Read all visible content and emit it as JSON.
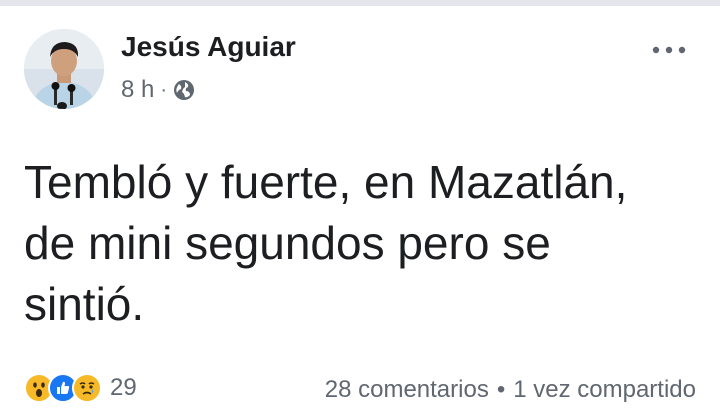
{
  "post": {
    "author": "Jesús Aguiar",
    "time": "8 h",
    "separator": "·",
    "privacy_icon": "globe-icon",
    "text": "Tembló y fuerte, en Mazatlán,\nde mini segundos pero se\nsintió.",
    "reactions": {
      "icons": [
        "wow-emoji-icon",
        "like-icon",
        "sad-emoji-icon"
      ],
      "count": "29"
    },
    "comments": "28 comentarios",
    "dot": "•",
    "shares": "1 vez compartido"
  },
  "colors": {
    "like_blue": "#1877f2",
    "emoji_yellow": "#f7b928",
    "meta_gray": "#606770"
  }
}
